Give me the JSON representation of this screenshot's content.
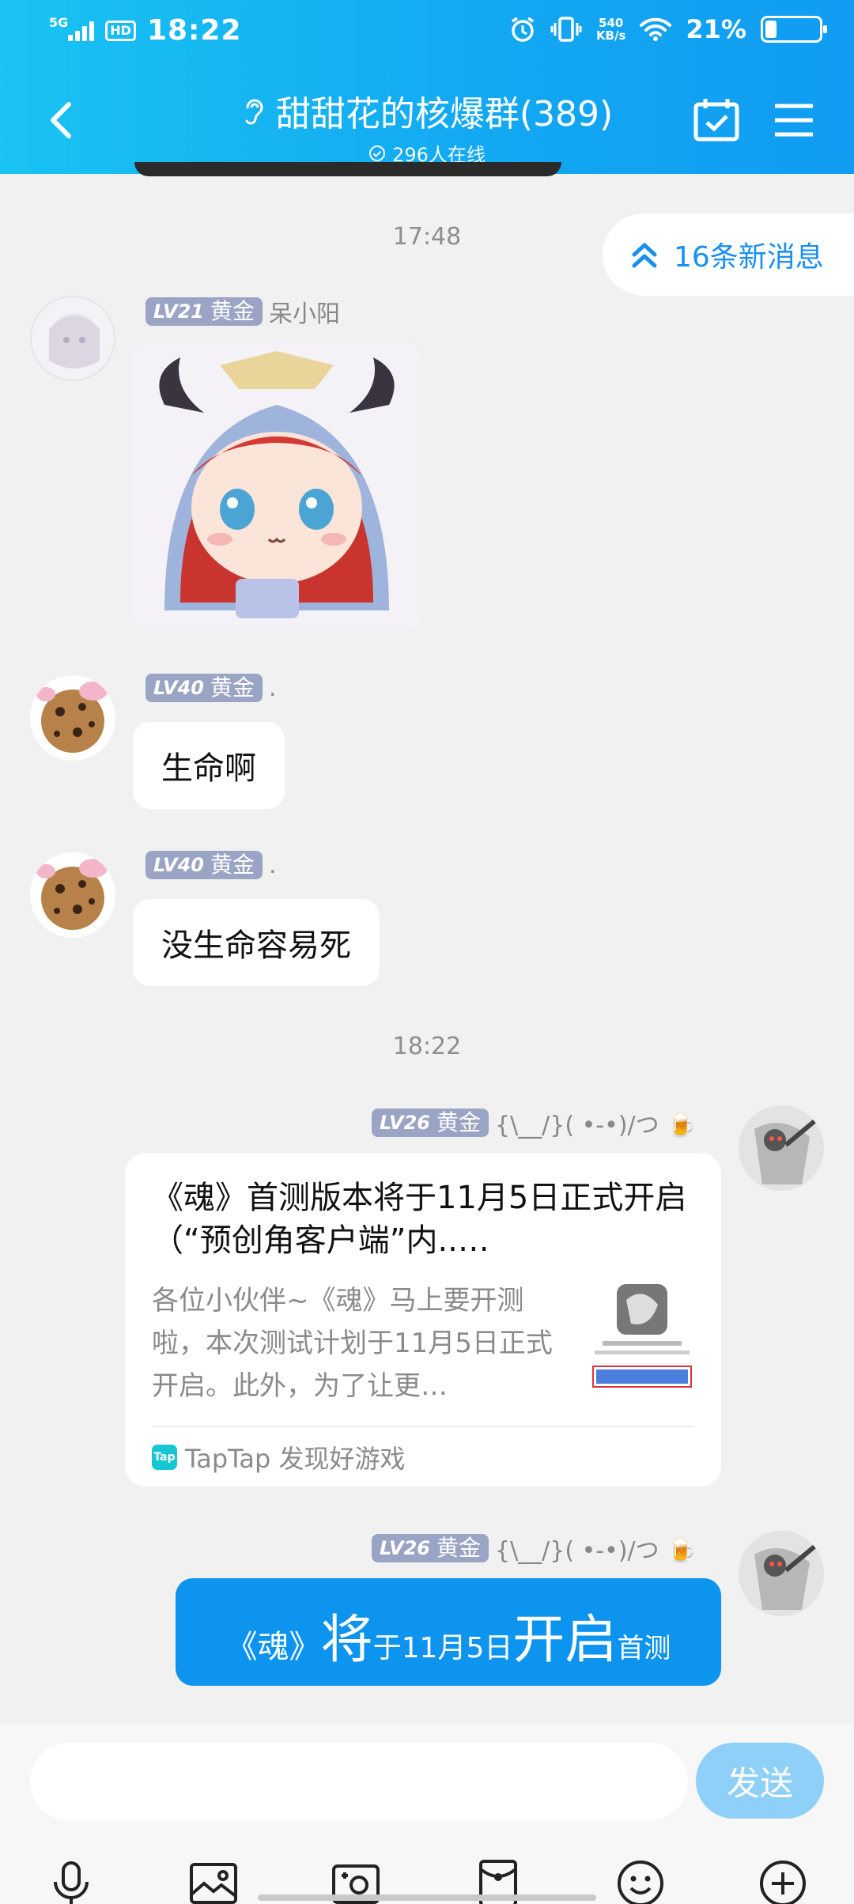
{
  "status_bar": {
    "time": "18:22",
    "network": "5G",
    "hd": "HD",
    "speed_value": "540",
    "speed_unit": "KB/s",
    "battery": "21%"
  },
  "header": {
    "title": "甜甜花的核爆群(389)",
    "online": "296人在线"
  },
  "new_messages": "16条新消息",
  "timestamps": [
    "17:48",
    "18:22"
  ],
  "messages": [
    {
      "level": "LV21",
      "tier": "黄金",
      "sender": "呆小阳"
    },
    {
      "level": "LV40",
      "tier": "黄金",
      "sender": ".",
      "text": "生命啊"
    },
    {
      "level": "LV40",
      "tier": "黄金",
      "sender": ".",
      "text": "没生命容易死"
    },
    {
      "level": "LV26",
      "tier": "黄金",
      "sender": "{\\__/}( •-•)/つ 🍺",
      "card": {
        "title": "《魂》首测版本将于11月5日正式开启（“预创角客户端”内..…",
        "desc": "各位小伙伴~《魂》马上要开测啦，本次测试计划于11月5日正式开启。此外，为了让更…",
        "source": "TapTap 发现好游戏",
        "source_icon": "Tap"
      }
    },
    {
      "level": "LV26",
      "tier": "黄金",
      "sender": "{\\__/}( •-•)/つ 🍺",
      "parts": [
        "《魂》",
        "将",
        "于11月5日",
        "开启",
        "首测"
      ]
    }
  ],
  "input": {
    "placeholder": "",
    "send_label": "发送"
  },
  "colors": {
    "header_start": "#19c3f3",
    "header_end": "#109cf2",
    "accent": "#0d94ef",
    "badge": "#9aa4c4"
  }
}
